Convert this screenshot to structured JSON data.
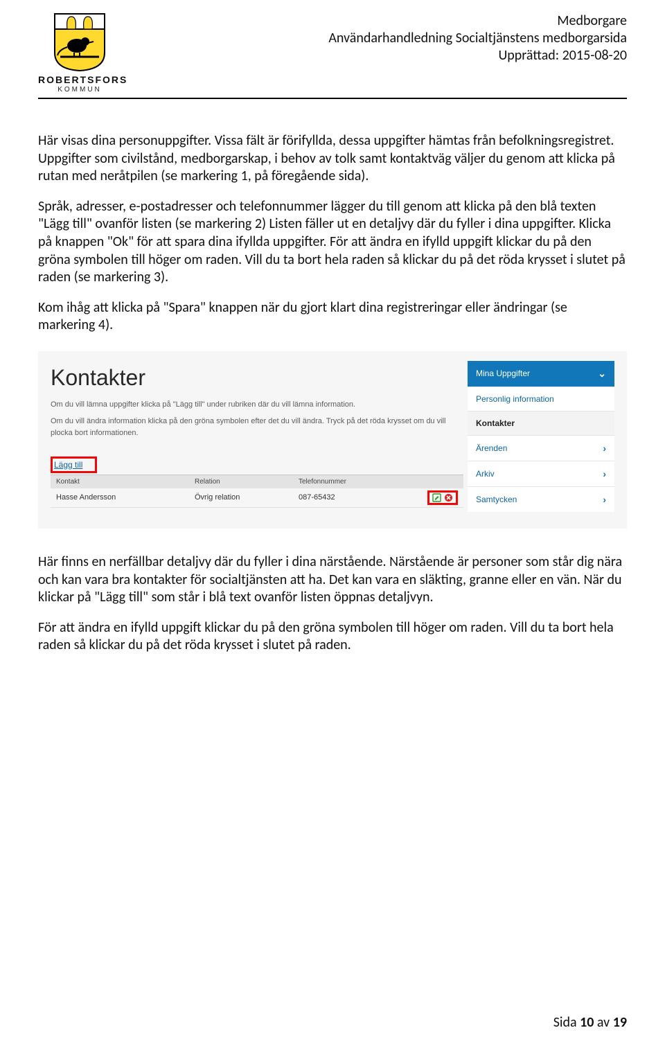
{
  "header": {
    "line1": "Medborgare",
    "line2": "Användarhandledning Socialtjänstens medborgarsida",
    "line3": "Upprättad: 2015-08-20",
    "org_name": "ROBERTSFORS",
    "org_sub": "KOMMUN"
  },
  "body": {
    "p1": "Här visas dina personuppgifter. Vissa fält är förifyllda, dessa uppgifter hämtas från befolkningsregistret. Uppgifter som civilstånd, medborgarskap, i behov av tolk samt kontaktväg väljer du genom att klicka på rutan med neråtpilen (se markering 1, på föregående sida).",
    "p2": "Språk, adresser, e-postadresser och telefonnummer lägger du till genom att klicka på den blå texten \"Lägg till\" ovanför listen (se markering 2) Listen fäller ut en detaljvy där du fyller i dina uppgifter. Klicka på knappen \"Ok\" för att spara dina ifyllda uppgifter. För att ändra en ifylld uppgift klickar du på den gröna symbolen till höger om raden. Vill du ta bort hela raden så klickar du på det röda krysset i slutet på raden (se markering 3).",
    "p3": "Kom ihåg att klicka på \"Spara\" knappen när du gjort klart dina registreringar eller ändringar (se markering 4).",
    "p4": "Här finns en nerfällbar detaljvy där du fyller i dina närstående. Närstående är personer som står dig nära och kan vara bra kontakter för socialtjänsten att ha. Det kan vara en släkting, granne eller en vän. När du klickar på \"Lägg till\" som står i blå text ovanför listen öppnas detaljvyn.",
    "p5": "För att ändra en ifylld uppgift klickar du på den gröna symbolen till höger om raden. Vill du ta bort hela raden så klickar du på det röda krysset i slutet på raden."
  },
  "screenshot": {
    "title": "Kontakter",
    "desc1": "Om du vill lämna uppgifter klicka på \"Lägg till\" under rubriken där du vill lämna information.",
    "desc2": "Om du vill ändra information klicka på den gröna symbolen efter det du vill ändra. Tryck på det röda krysset om du vill plocka bort informationen.",
    "add": "Lägg till",
    "cols": {
      "c1": "Kontakt",
      "c2": "Relation",
      "c3": "Telefonnummer"
    },
    "row": {
      "name": "Hasse Andersson",
      "relation": "Övrig relation",
      "phone": "087-65432"
    },
    "menu": {
      "m1": "Mina Uppgifter",
      "m2": "Personlig information",
      "m3": "Kontakter",
      "m4": "Ärenden",
      "m5": "Arkiv",
      "m6": "Samtycken"
    }
  },
  "footer": {
    "label": "Sida ",
    "page": "10",
    "of": " av ",
    "total": "19"
  }
}
